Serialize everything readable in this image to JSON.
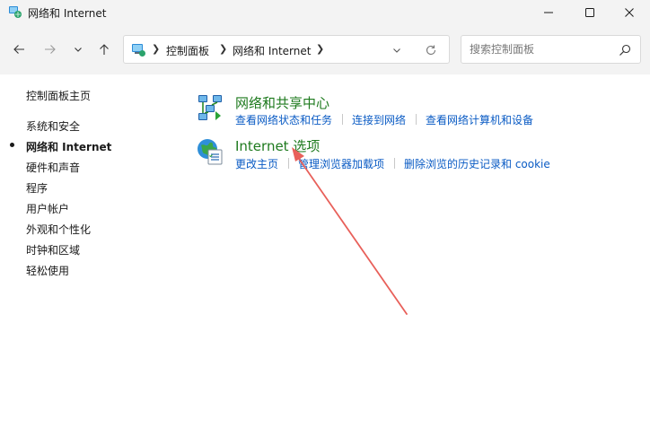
{
  "window": {
    "title": "网络和 Internet"
  },
  "navigation": {
    "breadcrumbs": [
      "控制面板",
      "网络和 Internet"
    ],
    "search_placeholder": "搜索控制面板"
  },
  "sidebar": {
    "home": "控制面板主页",
    "items": [
      {
        "label": "系统和安全",
        "active": false
      },
      {
        "label": "网络和 Internet",
        "active": true
      },
      {
        "label": "硬件和声音",
        "active": false
      },
      {
        "label": "程序",
        "active": false
      },
      {
        "label": "用户帐户",
        "active": false
      },
      {
        "label": "外观和个性化",
        "active": false
      },
      {
        "label": "时钟和区域",
        "active": false
      },
      {
        "label": "轻松使用",
        "active": false
      }
    ]
  },
  "categories": [
    {
      "title": "网络和共享中心",
      "icon": "network-sharing-center-icon",
      "tasks": [
        "查看网络状态和任务",
        "连接到网络",
        "查看网络计算机和设备"
      ]
    },
    {
      "title": "Internet 选项",
      "icon": "internet-options-icon",
      "tasks": [
        "更改主页",
        "管理浏览器加载项",
        "删除浏览的历史记录和 cookie"
      ]
    }
  ],
  "colors": {
    "category_title": "#1e7a1e",
    "task_link": "#0a5bc4",
    "annotation_arrow": "#e8605a",
    "chrome_background": "#f3f3f3"
  },
  "annotation": {
    "type": "arrow",
    "icon": "annotation-arrow-icon"
  }
}
